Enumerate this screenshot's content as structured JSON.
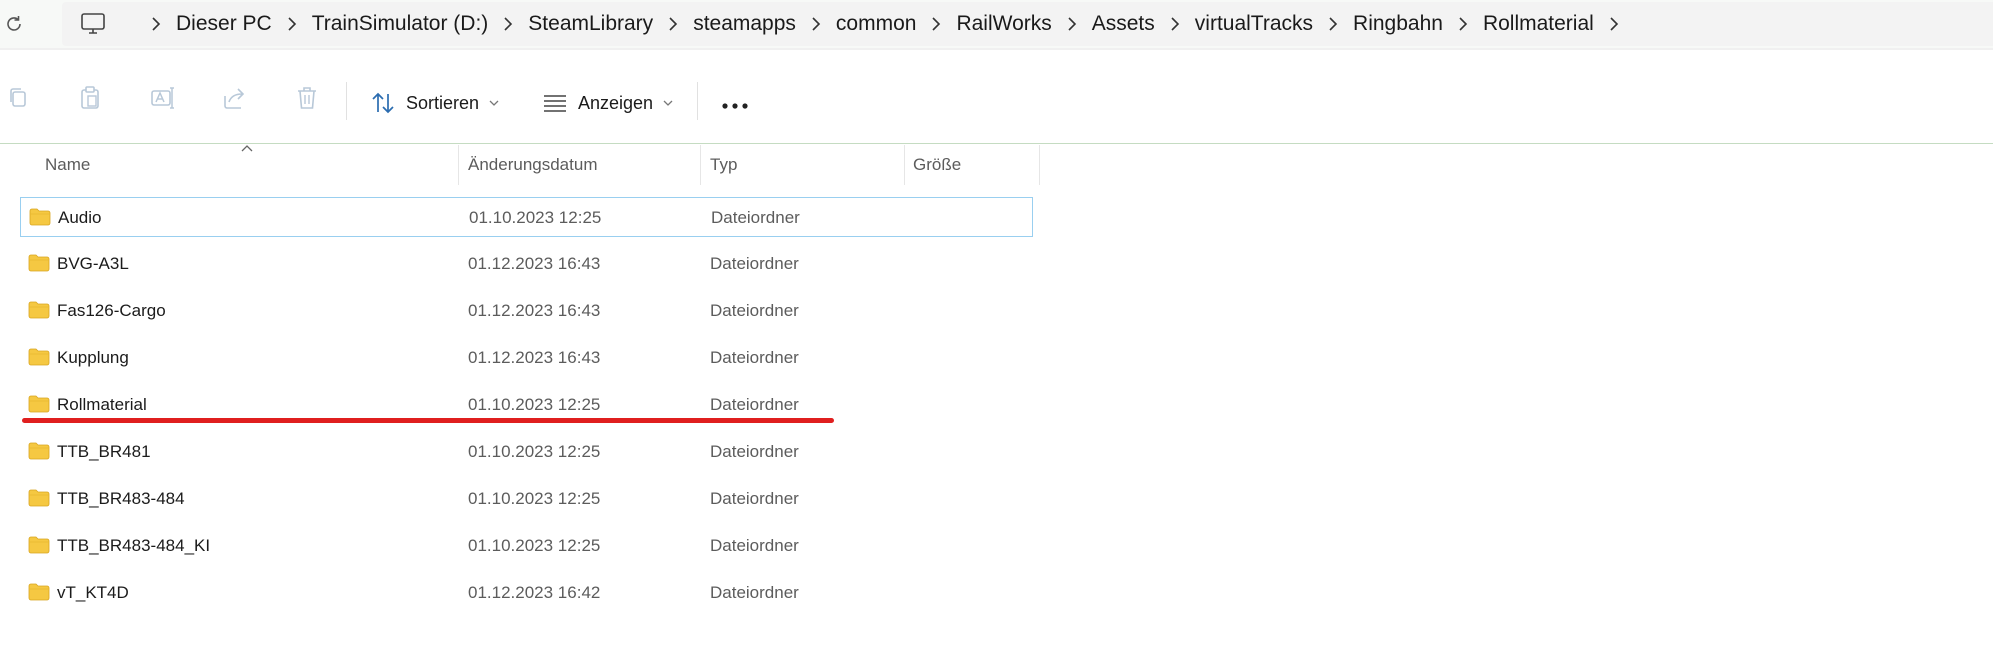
{
  "breadcrumb": {
    "root_icon": "computer-icon",
    "items": [
      "Dieser PC",
      "TrainSimulator (D:)",
      "SteamLibrary",
      "steamapps",
      "common",
      "RailWorks",
      "Assets",
      "virtualTracks",
      "Ringbahn",
      "Rollmaterial"
    ]
  },
  "toolbar": {
    "sort_label": "Sortieren",
    "view_label": "Anzeigen",
    "more_label": "•••"
  },
  "columns": {
    "name": "Name",
    "date": "Änderungsdatum",
    "type": "Typ",
    "size": "Größe"
  },
  "rows": [
    {
      "name": "Audio",
      "date": "01.10.2023 12:25",
      "type": "Dateiordner"
    },
    {
      "name": "BVG-A3L",
      "date": "01.12.2023 16:43",
      "type": "Dateiordner"
    },
    {
      "name": "Fas126-Cargo",
      "date": "01.12.2023 16:43",
      "type": "Dateiordner"
    },
    {
      "name": "Kupplung",
      "date": "01.12.2023 16:43",
      "type": "Dateiordner"
    },
    {
      "name": "Rollmaterial",
      "date": "01.10.2023 12:25",
      "type": "Dateiordner"
    },
    {
      "name": "TTB_BR481",
      "date": "01.10.2023 12:25",
      "type": "Dateiordner"
    },
    {
      "name": "TTB_BR483-484",
      "date": "01.10.2023 12:25",
      "type": "Dateiordner"
    },
    {
      "name": "TTB_BR483-484_KI",
      "date": "01.10.2023 12:25",
      "type": "Dateiordner"
    },
    {
      "name": "vT_KT4D",
      "date": "01.12.2023 16:42",
      "type": "Dateiordner"
    }
  ],
  "colors": {
    "folder": "#f5c842",
    "selection_border": "#99cff0",
    "annotation_underline": "#e01f1f"
  }
}
